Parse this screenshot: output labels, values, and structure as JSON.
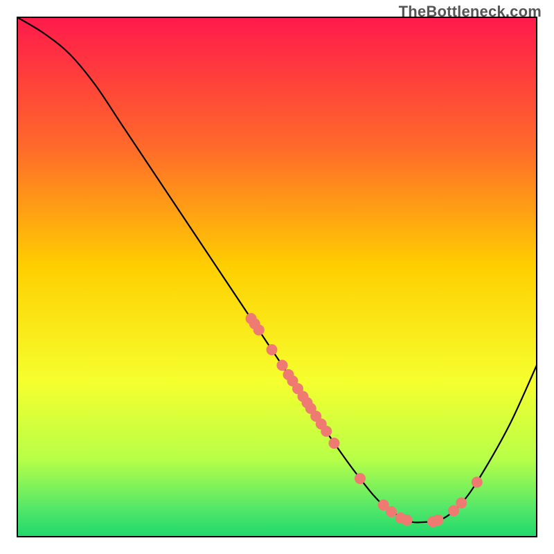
{
  "watermark": "TheBottleneck.com",
  "chart_data": {
    "type": "line",
    "title": "",
    "xlabel": "",
    "ylabel": "",
    "xlim": [
      0,
      100
    ],
    "ylim": [
      0,
      100
    ],
    "grid": false,
    "legend": false,
    "annotations": [],
    "background_gradient": {
      "top_color": "#ff1a4b",
      "mid_colors": [
        "#ffcf00",
        "#eaff3a"
      ],
      "bottom_color": "#1fd86b"
    },
    "curve_description": "Smooth descending curve from top-left corner to a minimum trough near x≈78 at y≈3, then rises again toward the right edge reaching y≈33 at x=100.",
    "curve_points": [
      {
        "x": 0,
        "y": 100
      },
      {
        "x": 5,
        "y": 97
      },
      {
        "x": 10,
        "y": 93
      },
      {
        "x": 15,
        "y": 87
      },
      {
        "x": 20,
        "y": 79.5
      },
      {
        "x": 25,
        "y": 72
      },
      {
        "x": 30,
        "y": 64.5
      },
      {
        "x": 35,
        "y": 57
      },
      {
        "x": 40,
        "y": 49.5
      },
      {
        "x": 45,
        "y": 42
      },
      {
        "x": 50,
        "y": 34.5
      },
      {
        "x": 55,
        "y": 27
      },
      {
        "x": 60,
        "y": 19.5
      },
      {
        "x": 65,
        "y": 12.5
      },
      {
        "x": 70,
        "y": 6.5
      },
      {
        "x": 75,
        "y": 3.2
      },
      {
        "x": 78,
        "y": 2.8
      },
      {
        "x": 82,
        "y": 3.5
      },
      {
        "x": 86,
        "y": 7
      },
      {
        "x": 90,
        "y": 13
      },
      {
        "x": 95,
        "y": 22
      },
      {
        "x": 100,
        "y": 33
      }
    ],
    "scatter_points": [
      {
        "x": 45.0,
        "y": 42.0
      },
      {
        "x": 45.7,
        "y": 41.0
      },
      {
        "x": 46.5,
        "y": 39.8
      },
      {
        "x": 49.0,
        "y": 36.0
      },
      {
        "x": 51.0,
        "y": 33.0
      },
      {
        "x": 52.2,
        "y": 31.2
      },
      {
        "x": 53.0,
        "y": 30.0
      },
      {
        "x": 54.0,
        "y": 28.5
      },
      {
        "x": 55.0,
        "y": 27.0
      },
      {
        "x": 55.8,
        "y": 25.8
      },
      {
        "x": 56.5,
        "y": 24.7
      },
      {
        "x": 57.5,
        "y": 23.2
      },
      {
        "x": 58.5,
        "y": 21.7
      },
      {
        "x": 59.5,
        "y": 20.3
      },
      {
        "x": 61.0,
        "y": 18.0
      },
      {
        "x": 66.0,
        "y": 11.2
      },
      {
        "x": 70.5,
        "y": 6.1
      },
      {
        "x": 72.0,
        "y": 4.8
      },
      {
        "x": 73.8,
        "y": 3.6
      },
      {
        "x": 75.0,
        "y": 3.2
      },
      {
        "x": 80.0,
        "y": 2.9
      },
      {
        "x": 81.0,
        "y": 3.2
      },
      {
        "x": 84.0,
        "y": 5.0
      },
      {
        "x": 85.5,
        "y": 6.5
      },
      {
        "x": 88.5,
        "y": 10.5
      }
    ],
    "scatter_color": "#ef7a72",
    "scatter_radius_px": 8
  }
}
